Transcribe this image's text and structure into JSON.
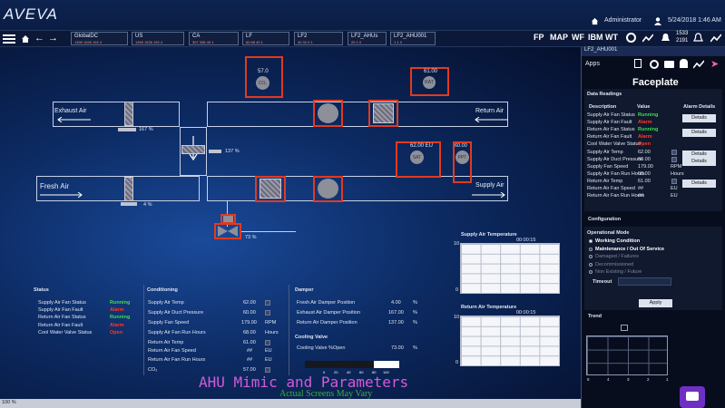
{
  "header": {
    "logo": "AVEVA",
    "user": "Administrator",
    "datetime": "5/24/2018 1:46 AM",
    "kpi_top": "1533",
    "kpi_bottom": "2191"
  },
  "breadcrumbs": [
    {
      "label": "GlobalDC",
      "alarms": "1399  1526  192  4"
    },
    {
      "label": "US",
      "alarms": "1399  1526  192  4"
    },
    {
      "label": "CA",
      "alarms": "307  338  49  1"
    },
    {
      "label": "LF",
      "alarms": "60  68  40  1"
    },
    {
      "label": "LF2",
      "alarms": "42  32  0  1"
    },
    {
      "label": "LF2_AHUs",
      "alarms": "20  1  0"
    },
    {
      "label": "LF2_AHU001",
      "alarms": "1  1  3"
    }
  ],
  "nav_buttons": [
    "FP",
    "MAP",
    "WF",
    "IBM WT"
  ],
  "mimic": {
    "exhaust_air": "Exhaust Air",
    "return_air": "Return Air",
    "fresh_air": "Fresh Air",
    "supply_air": "Supply Air",
    "exhaust_damper_pct": "167 %",
    "return_damper_pct": "137 %",
    "fresh_damper_pct": "4 %",
    "valve_pct": "73 %",
    "co2_value": "57.0",
    "co2_label": "CO₂",
    "rat_value": "61.00",
    "rat_label": "RAT",
    "sat_value": "62.00 EU",
    "sat_label": "SAT",
    "ppt_value": "60.00",
    "ppt_label": "PPT"
  },
  "status_panel": {
    "title": "Status",
    "items": [
      {
        "label": "Supply Air Fan Status",
        "value": "Running",
        "state": "ok"
      },
      {
        "label": "Supply Air Fan Fault",
        "value": "Alarm",
        "state": "alarm"
      },
      {
        "label": "Return Air Fan Status",
        "value": "Running",
        "state": "ok"
      },
      {
        "label": "Return Air Fan Fault",
        "value": "Alarm",
        "state": "alarm"
      },
      {
        "label": "Cool Water Valve Status",
        "value": "Open",
        "state": "alarm"
      }
    ]
  },
  "conditioning_panel": {
    "title": "Conditioning",
    "items": [
      {
        "label": "Supply Air Temp",
        "value": "62.00",
        "unit": ""
      },
      {
        "label": "Supply Air Duct Pressure",
        "value": "60.00",
        "unit": ""
      },
      {
        "label": "Supply Fan Speed",
        "value": "179.00",
        "unit": "RPM"
      },
      {
        "label": "Supply Air Fan Run Hours",
        "value": "68.00",
        "unit": "Hours"
      },
      {
        "label": "Return Air Temp",
        "value": "61.00",
        "unit": ""
      },
      {
        "label": "Return Air Fan Speed",
        "value": "##",
        "unit": "EU"
      },
      {
        "label": "Return Air Fan Run Hours",
        "value": "##",
        "unit": "EU"
      },
      {
        "label": "CO₂",
        "value": "57.00",
        "unit": ""
      }
    ]
  },
  "damper_panel": {
    "title": "Damper",
    "items": [
      {
        "label": "Fresh Air Damper Position",
        "value": "4.00",
        "unit": "%"
      },
      {
        "label": "Exhaust Air Damper Position",
        "value": "167.00",
        "unit": "%"
      },
      {
        "label": "Return Air Damper Position",
        "value": "137.00",
        "unit": "%"
      }
    ]
  },
  "cooling_panel": {
    "title": "Cooling Valve",
    "items": [
      {
        "label": "Cooling Valve %Open",
        "value": "73.00",
        "unit": "%"
      }
    ]
  },
  "scale_ticks": [
    "0",
    "20",
    "40",
    "60",
    "80",
    "100"
  ],
  "charts": [
    {
      "title": "Supply Air Temperature",
      "time": "00:00:15",
      "y_top": "10",
      "y_bottom": "0"
    },
    {
      "title": "Return Air Temperature",
      "time": "00:00:15",
      "y_top": "10",
      "y_bottom": "0"
    }
  ],
  "overlay": {
    "title": "AHU Mimic and Parameters",
    "subtitle": "Actual Screens May Vary"
  },
  "faceplate": {
    "tab": "LF2_AHU001",
    "apps": "Apps",
    "title": "Faceplate",
    "readings_title": "Data Readings",
    "col_desc": "Description",
    "col_value": "Value",
    "col_alarm": "Alarm Details",
    "rows": [
      {
        "label": "Supply Air Fan Status",
        "value": "Running",
        "state": "ok",
        "unit": "",
        "details": "Details"
      },
      {
        "label": "Supply Air Fan Fault",
        "value": "Alarm",
        "state": "alarm",
        "unit": "",
        "details": ""
      },
      {
        "label": "Return Air Fan Status",
        "value": "Running",
        "state": "ok",
        "unit": "",
        "details": "Details"
      },
      {
        "label": "Return Air Fan Fault",
        "value": "Alarm",
        "state": "alarm",
        "unit": "",
        "details": ""
      },
      {
        "label": "Cool Water Valve Status",
        "value": "Open",
        "state": "alarm",
        "unit": "",
        "details": ""
      },
      {
        "label": "Supply Air Temp",
        "value": "62.00",
        "state": "",
        "unit": "",
        "details": "Details"
      },
      {
        "label": "Supply Air Duct Pressure",
        "value": "60.00",
        "state": "",
        "unit": "",
        "details": "Details"
      },
      {
        "label": "Supply Fan Speed",
        "value": "179.00",
        "state": "",
        "unit": "RPM",
        "details": ""
      },
      {
        "label": "Supply Air Fan Run Hours",
        "value": "68.00",
        "state": "",
        "unit": "Hours",
        "details": ""
      },
      {
        "label": "Return Air Temp",
        "value": "61.00",
        "state": "",
        "unit": "",
        "details": "Details"
      },
      {
        "label": "Return Air Fan Speed",
        "value": "##",
        "state": "",
        "unit": "EU",
        "details": ""
      },
      {
        "label": "Return Air Fan Run Hours",
        "value": "##",
        "state": "",
        "unit": "EU",
        "details": ""
      }
    ],
    "configuration": "Configuration",
    "operational_mode": "Operational Mode",
    "modes": [
      {
        "label": "Working Condition",
        "enabled": true,
        "selected": true
      },
      {
        "label": "Maintenance / Out Of Service",
        "enabled": true,
        "selected": false
      },
      {
        "label": "Damaged / Failures",
        "enabled": false,
        "selected": false
      },
      {
        "label": "Decommissioned",
        "enabled": false,
        "selected": false
      },
      {
        "label": "Non Existing / Future",
        "enabled": false,
        "selected": false
      }
    ],
    "timeout_label": "Timeout",
    "apply": "Apply",
    "trend": "Trend",
    "trend_ticks": [
      "5",
      "4",
      "3",
      "2",
      "1"
    ]
  },
  "statusbar": {
    "zoom": "100 %"
  }
}
